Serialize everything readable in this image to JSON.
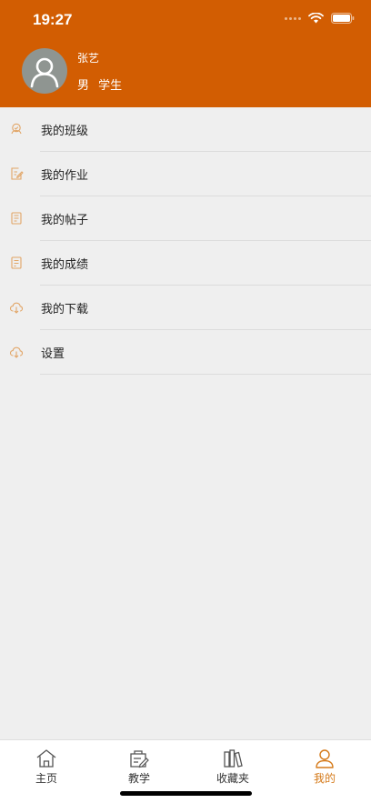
{
  "status_bar": {
    "time": "19:27"
  },
  "profile": {
    "name": "张艺",
    "gender": "男",
    "role": "学生"
  },
  "menu": [
    {
      "label": "我的班级",
      "icon": "class-icon"
    },
    {
      "label": "我的作业",
      "icon": "homework-icon"
    },
    {
      "label": "我的帖子",
      "icon": "posts-icon"
    },
    {
      "label": "我的成绩",
      "icon": "grades-icon"
    },
    {
      "label": "我的下载",
      "icon": "download-icon"
    },
    {
      "label": "设置",
      "icon": "settings-icon"
    }
  ],
  "tabs": [
    {
      "label": "主页",
      "icon": "home-icon",
      "active": false
    },
    {
      "label": "教学",
      "icon": "teaching-icon",
      "active": false
    },
    {
      "label": "收藏夹",
      "icon": "favorites-icon",
      "active": false
    },
    {
      "label": "我的",
      "icon": "profile-icon",
      "active": true
    }
  ],
  "colors": {
    "header": "#d25d02",
    "accent": "#d57a1a",
    "background": "#efefef"
  }
}
